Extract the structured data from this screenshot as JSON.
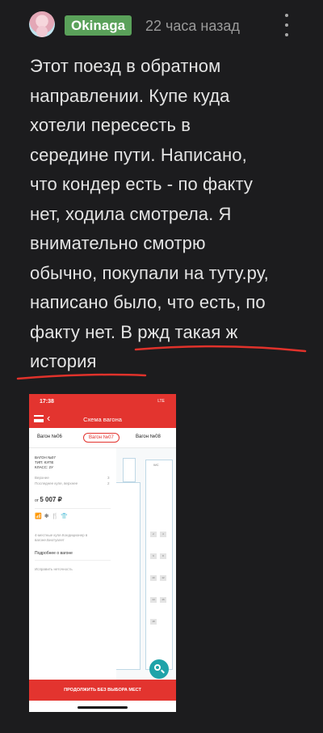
{
  "header": {
    "username": "Okinaga",
    "timestamp": "22 часа назад",
    "avatar_icon": "user-avatar",
    "menu_icon": "kebab-menu-icon",
    "badge_color": "#5aa15a"
  },
  "comment": {
    "lines": [
      "Этот поезд в обратном",
      "направлении. Купе куда",
      "хотели пересесть в",
      "середине пути. Написано,",
      "что кондер есть - по факту",
      "нет, ходила смотрела. Я",
      "внимательно смотрю",
      "обычно, покупали на туту.ру,",
      "написано было, что есть, по",
      "факту нет. В ржд такая ж",
      "история"
    ],
    "underline_color": "#e0322b"
  },
  "screenshot": {
    "status_time": "17:38",
    "status_net": "LTE",
    "nav_title": "Схема вагона",
    "tabs": [
      "Вагон №06",
      "Вагон №07",
      "Вагон №08"
    ],
    "active_tab": 1,
    "car_info": [
      "ВАГОН №07",
      "ТИП: КУПЕ",
      "КЛАСС: 2У"
    ],
    "seats": [
      {
        "label": "Верхнее",
        "count": "3"
      },
      {
        "label": "Последнее купе, верхнее",
        "count": "2"
      }
    ],
    "price_prefix": "от",
    "price": "5 007 ₽",
    "amenity_icons": [
      "wifi-icon",
      "snowflake-icon",
      "food-icon",
      "clothes-icon"
    ],
    "description": "4-местные купе.Кондиционер в вагоне.Биотуалет",
    "more_link": "Подробнее о вагоне",
    "report_link": "Исправить неточность",
    "map_label": "WC",
    "seat_numbers": [
      "2",
      "4",
      "6",
      "8",
      "10",
      "12",
      "14",
      "16",
      "18"
    ],
    "cta": "ПРОДОЛЖИТЬ БЕЗ ВЫБОРА МЕСТ",
    "accent": "#e3342f"
  }
}
